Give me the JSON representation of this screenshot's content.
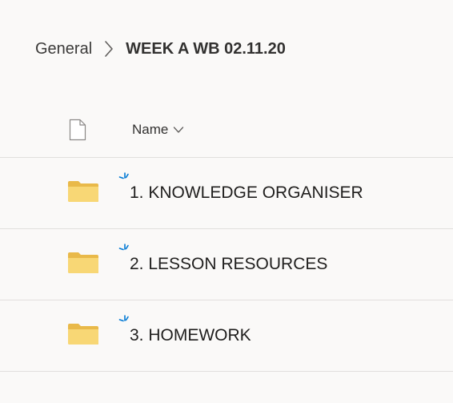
{
  "breadcrumb": {
    "parent": "General",
    "current": "WEEK A WB 02.11.20"
  },
  "list_header": {
    "name_label": "Name"
  },
  "items": [
    {
      "name": "1. KNOWLEDGE ORGANISER",
      "type_icon": "folder-icon",
      "badge": "new-icon"
    },
    {
      "name": "2. LESSON RESOURCES",
      "type_icon": "folder-icon",
      "badge": "new-icon"
    },
    {
      "name": "3. HOMEWORK",
      "type_icon": "folder-icon",
      "badge": "new-icon"
    }
  ],
  "colors": {
    "background": "#faf9f8",
    "folder": "#f8d775",
    "new_badge": "#0078d4",
    "divider": "#e1dfdd"
  }
}
